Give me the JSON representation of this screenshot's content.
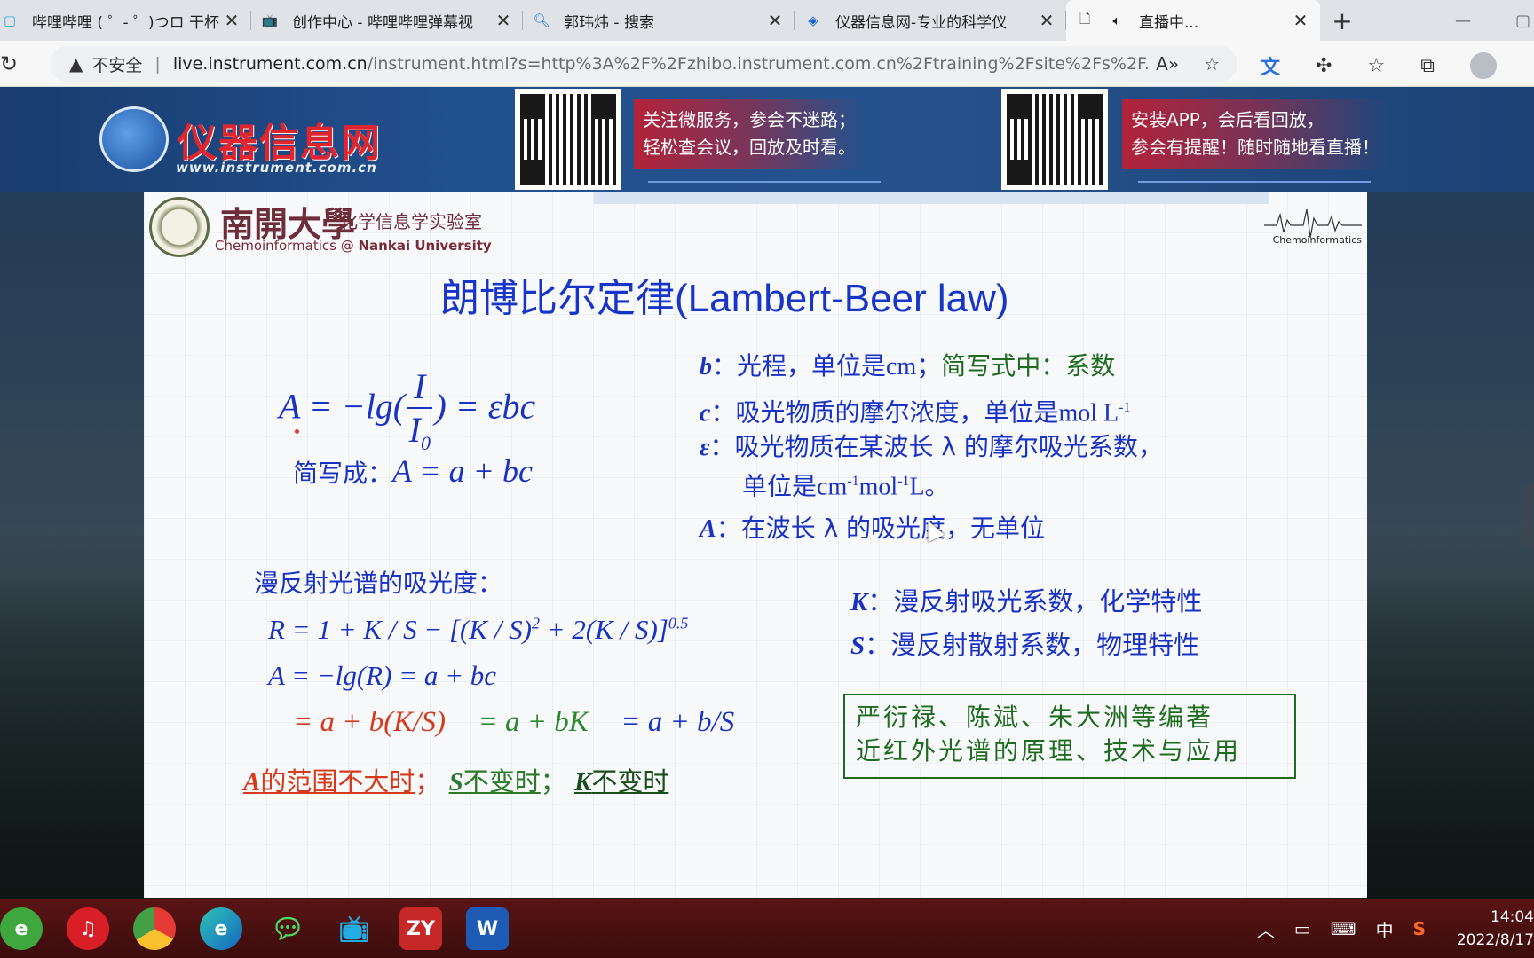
{
  "browser": {
    "tabs": [
      {
        "title": "哔哩哔哩 ( ゜- ゜)つロ 干杯",
        "icon": "bilibili-icon"
      },
      {
        "title": "创作中心 - 哔哩哔哩弹幕视",
        "icon": "bilibili-tv-icon"
      },
      {
        "title": "郭玮炜 - 搜索",
        "icon": "search-icon"
      },
      {
        "title": "仪器信息网-专业的科学仪",
        "icon": "instrument-logo-icon"
      },
      {
        "title": "直播中...",
        "icon": "document-icon",
        "active": true
      }
    ],
    "new_tab": "+",
    "address": {
      "security_label": "不安全",
      "host": "live.instrument.com.cn",
      "path": "/instrument.html?s=http%3A%2F%2Fzhibo.instrument.com.cn%2Ftraining%2Fsite%2Fs%2F..."
    }
  },
  "banner": {
    "logo_text": "仪器信息网",
    "logo_url": "www.instrument.com.cn",
    "promo1": [
      "关注微服务，参会不迷路；",
      "轻松查会议，回放及时看。"
    ],
    "promo2": [
      "安装APP，会后看回放，",
      "参会有提醒！随时随地看直播！"
    ]
  },
  "slide": {
    "lab_name": "南開大學",
    "lab_subtitle": "化学信息学实验室",
    "lab_en_prefix": "Chemoinformatics @",
    "lab_en_bold": "Nankai University",
    "corner_logo_label": "Chemoinformatics",
    "title": "朗博比尔定律(Lambert-Beer law)",
    "eq1": {
      "lhs": "A = −lg(",
      "num": "I",
      "den": "I",
      "den_sub": "0",
      "rhs": ") = εbc"
    },
    "eq2": {
      "prefix": "简写成：",
      "formula": "A = a + bc"
    },
    "definitions": {
      "b_sym": "b",
      "b_text": "：光程，单位是",
      "b_unit": "cm",
      "b_sep": "；",
      "b_green": "简写式中：系数",
      "c_sym": "c",
      "c_text": "：吸光物质的摩尔浓度，单位是",
      "c_unit": "mol L",
      "c_sup": "-1",
      "e_sym": "ε",
      "e_text": "：吸光物质在某波长 λ 的摩尔吸光系数，",
      "e_line2": "单位是",
      "e_unit1": "cm",
      "e_sup1": "-1",
      "e_unit2": "mol",
      "e_sup2": "-1",
      "e_unit3": "L。",
      "a_sym": "A",
      "a_text": "：在波长 λ 的吸光度，无单位"
    },
    "diffuse_title": "漫反射光谱的吸光度：",
    "eq3_main": "R = 1 + K / S − [(K / S)",
    "eq3_sup2": "2",
    "eq3_mid": " + 2(K / S)]",
    "eq3_sup05": "0.5",
    "eq4": "A = −lg(R) = a + bc",
    "eq5": {
      "red": "= a + b(K/S)",
      "green": "= a + bK",
      "blue": "= a + b/S"
    },
    "conditions": {
      "c1_sym": "A",
      "c1": "的范围不大时",
      "semi1": "；",
      "c2_sym": "S",
      "c2": "不变时",
      "semi2": "；",
      "c3_sym": "K",
      "c3": "不变时"
    },
    "ks": {
      "k_sym": "K",
      "k_text": "：漫反射吸光系数，化学特性",
      "s_sym": "S",
      "s_text": "：漫反射散射系数，物理特性"
    },
    "reference": [
      "严衍禄、陈斌、朱大洲等编著",
      "近红外光谱的原理、技术与应用"
    ]
  },
  "taskbar": {
    "apps": [
      "360-browser-icon",
      "netease-music-icon",
      "chrome-icon",
      "edge-icon",
      "wechat-icon",
      "bilibili-icon",
      "zy-icon",
      "word-icon"
    ],
    "zy_label": "ZY",
    "word_label": "W",
    "ime": "中",
    "time": "14:04",
    "date": "2022/8/17"
  },
  "colors": {
    "slide_blue": "#1a32c4",
    "slide_green": "#1f6b1f",
    "slide_red": "#d63a1c",
    "logo_red": "#e1252f"
  }
}
